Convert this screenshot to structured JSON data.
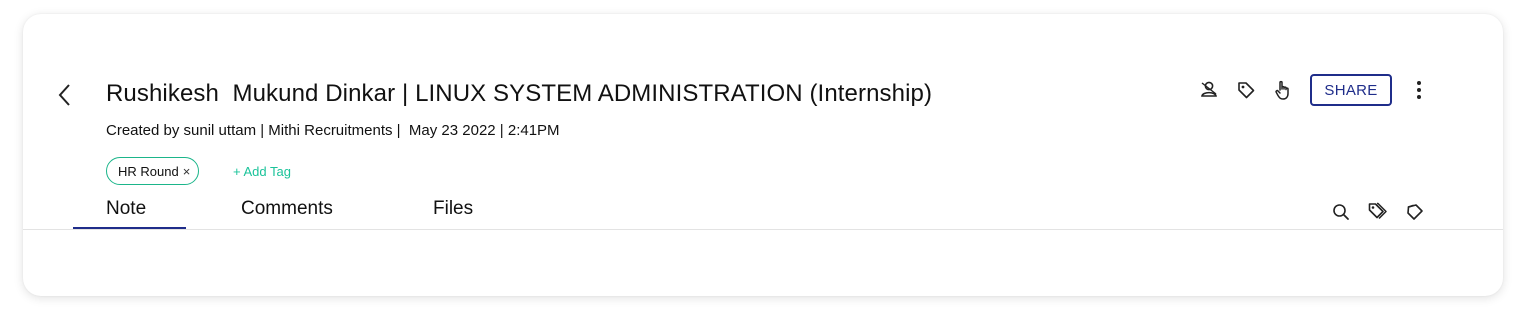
{
  "header": {
    "title": "Rushikesh  Mukund Dinkar | LINUX SYSTEM ADMINISTRATION (Internship)",
    "meta": "Created by sunil uttam | Mithi Recruitments |  May 23 2022 | 2:41PM",
    "share_label": "SHARE"
  },
  "tags": {
    "items": [
      {
        "label": "HR Round",
        "remove": "×"
      }
    ],
    "add_label": "+ Add Tag"
  },
  "tabs": [
    {
      "label": "Note",
      "active": true
    },
    {
      "label": "Comments",
      "active": false
    },
    {
      "label": "Files",
      "active": false
    }
  ],
  "icons": {
    "header": [
      "assign-user-icon",
      "tag-icon",
      "hand-pointer-icon",
      "more-vertical-icon"
    ],
    "toolbar": [
      "search-icon",
      "tags-icon",
      "unlabel-icon"
    ]
  },
  "colors": {
    "accent": "#1f2d8a",
    "tag_green": "#1bb58a"
  }
}
